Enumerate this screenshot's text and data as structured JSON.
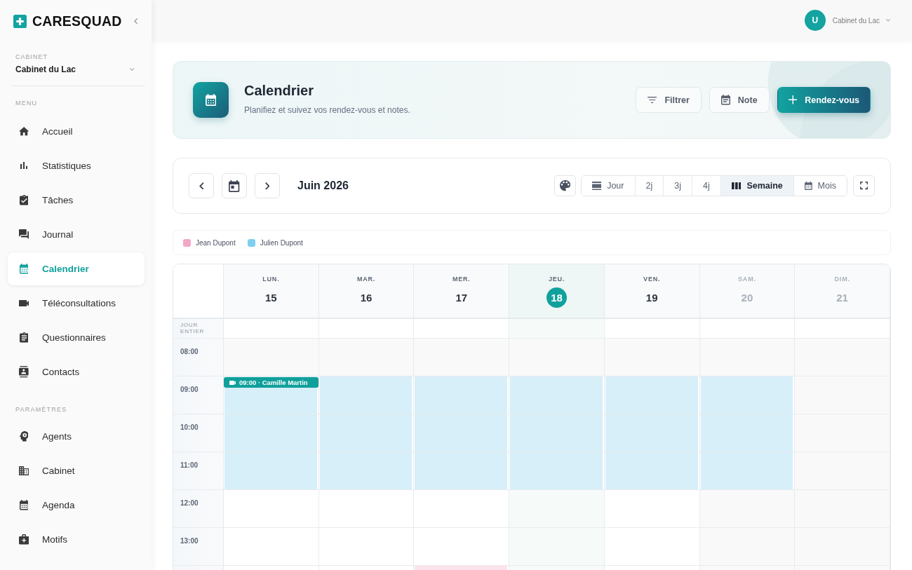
{
  "sidebar": {
    "logo": "CARESQUAD",
    "cabinet": {
      "label": "CABINET",
      "value": "Cabinet du Lac"
    },
    "sections": [
      {
        "title": "MENU",
        "items": [
          {
            "label": "Accueil",
            "selected": false
          },
          {
            "label": "Statistiques",
            "selected": false
          },
          {
            "label": "Tâches",
            "selected": false
          },
          {
            "label": "Journal",
            "selected": false
          },
          {
            "label": "Calendrier",
            "selected": true
          },
          {
            "label": "Téléconsultations",
            "selected": false
          },
          {
            "label": "Questionnaires",
            "selected": false
          },
          {
            "label": "Contacts",
            "selected": false
          }
        ]
      },
      {
        "title": "PARAMÈTRES",
        "items": [
          {
            "label": "Agents",
            "selected": false
          },
          {
            "label": "Cabinet",
            "selected": false
          },
          {
            "label": "Agenda",
            "selected": false
          },
          {
            "label": "Motifs",
            "selected": false
          }
        ]
      }
    ]
  },
  "header": {
    "avatar": "U",
    "account": "Cabinet du Lac"
  },
  "banner": {
    "title": "Calendrier",
    "subtitle": "Planifiez et suivez vos rendez-vous et notes.",
    "buttons": [
      {
        "label": "Filtrer",
        "kind": "secondary"
      },
      {
        "label": "Note",
        "kind": "secondary"
      },
      {
        "label": "Rendez-vous",
        "kind": "primary"
      }
    ]
  },
  "toolbar": {
    "period": "Juin 2026",
    "views": [
      {
        "label": "Jour",
        "selected": false
      },
      {
        "label": "2j",
        "selected": false
      },
      {
        "label": "3j",
        "selected": false
      },
      {
        "label": "4j",
        "selected": false
      },
      {
        "label": "Semaine",
        "selected": true
      },
      {
        "label": "Mois",
        "selected": false
      }
    ]
  },
  "legend": [
    {
      "name": "Jean Dupont",
      "color": "#f4a6c6"
    },
    {
      "name": "Julien Dupont",
      "color": "#7fcfef"
    }
  ],
  "calendar": {
    "all_day_label": "JOUR ENTIER",
    "days": [
      {
        "name": "LUN.",
        "number": "15",
        "today": false,
        "weekend": false
      },
      {
        "name": "MAR.",
        "number": "16",
        "today": false,
        "weekend": false
      },
      {
        "name": "MER.",
        "number": "17",
        "today": false,
        "weekend": false
      },
      {
        "name": "JEU.",
        "number": "18",
        "today": true,
        "weekend": false
      },
      {
        "name": "VEN.",
        "number": "19",
        "today": false,
        "weekend": false
      },
      {
        "name": "SAM.",
        "number": "20",
        "today": false,
        "weekend": true
      },
      {
        "name": "DIM.",
        "number": "21",
        "today": false,
        "weekend": true
      }
    ],
    "rows": [
      {
        "time": "08:00",
        "cells": [
          {
            "kind": "off"
          },
          {
            "kind": "off"
          },
          {
            "kind": "off"
          },
          {
            "kind": "off"
          },
          {
            "kind": "off"
          },
          {
            "kind": "off"
          },
          {
            "kind": "off"
          }
        ]
      },
      {
        "time": "09:00",
        "cells": [
          {
            "kind": "slot",
            "color": "#d7eff9",
            "event": {
              "label": "09:00 · Camille Martin"
            }
          },
          {
            "kind": "slot",
            "color": "#d7eff9"
          },
          {
            "kind": "slot",
            "color": "#d7eff9"
          },
          {
            "kind": "slot",
            "color": "#d7eff9"
          },
          {
            "kind": "slot",
            "color": "#d7eff9"
          },
          {
            "kind": "slot",
            "color": "#d7eff9"
          },
          {
            "kind": "off"
          }
        ]
      },
      {
        "time": "10:00",
        "cells": [
          {
            "kind": "slot",
            "color": "#d7eff9"
          },
          {
            "kind": "slot",
            "color": "#d7eff9"
          },
          {
            "kind": "slot",
            "color": "#d7eff9"
          },
          {
            "kind": "slot",
            "color": "#d7eff9"
          },
          {
            "kind": "slot",
            "color": "#d7eff9"
          },
          {
            "kind": "slot",
            "color": "#d7eff9"
          },
          {
            "kind": "off"
          }
        ]
      },
      {
        "time": "11:00",
        "cells": [
          {
            "kind": "slot",
            "color": "#d7eff9"
          },
          {
            "kind": "slot",
            "color": "#d7eff9"
          },
          {
            "kind": "slot",
            "color": "#d7eff9"
          },
          {
            "kind": "slot",
            "color": "#d7eff9"
          },
          {
            "kind": "slot",
            "color": "#d7eff9"
          },
          {
            "kind": "slot",
            "color": "#d7eff9"
          },
          {
            "kind": "off"
          }
        ]
      },
      {
        "time": "12:00",
        "cells": [
          {
            "kind": "free"
          },
          {
            "kind": "free"
          },
          {
            "kind": "free"
          },
          {
            "kind": "free"
          },
          {
            "kind": "free"
          },
          {
            "kind": "off"
          },
          {
            "kind": "off"
          }
        ]
      },
      {
        "time": "13:00",
        "cells": [
          {
            "kind": "free"
          },
          {
            "kind": "free"
          },
          {
            "kind": "free"
          },
          {
            "kind": "free"
          },
          {
            "kind": "free"
          },
          {
            "kind": "off"
          },
          {
            "kind": "off"
          }
        ]
      },
      {
        "cells": [
          {
            "kind": "free"
          },
          {
            "kind": "free"
          },
          {
            "kind": "slot",
            "color": "#fce3ec"
          },
          {
            "kind": "free"
          },
          {
            "kind": "free"
          },
          {
            "kind": "off"
          },
          {
            "kind": "off"
          }
        ]
      }
    ]
  }
}
